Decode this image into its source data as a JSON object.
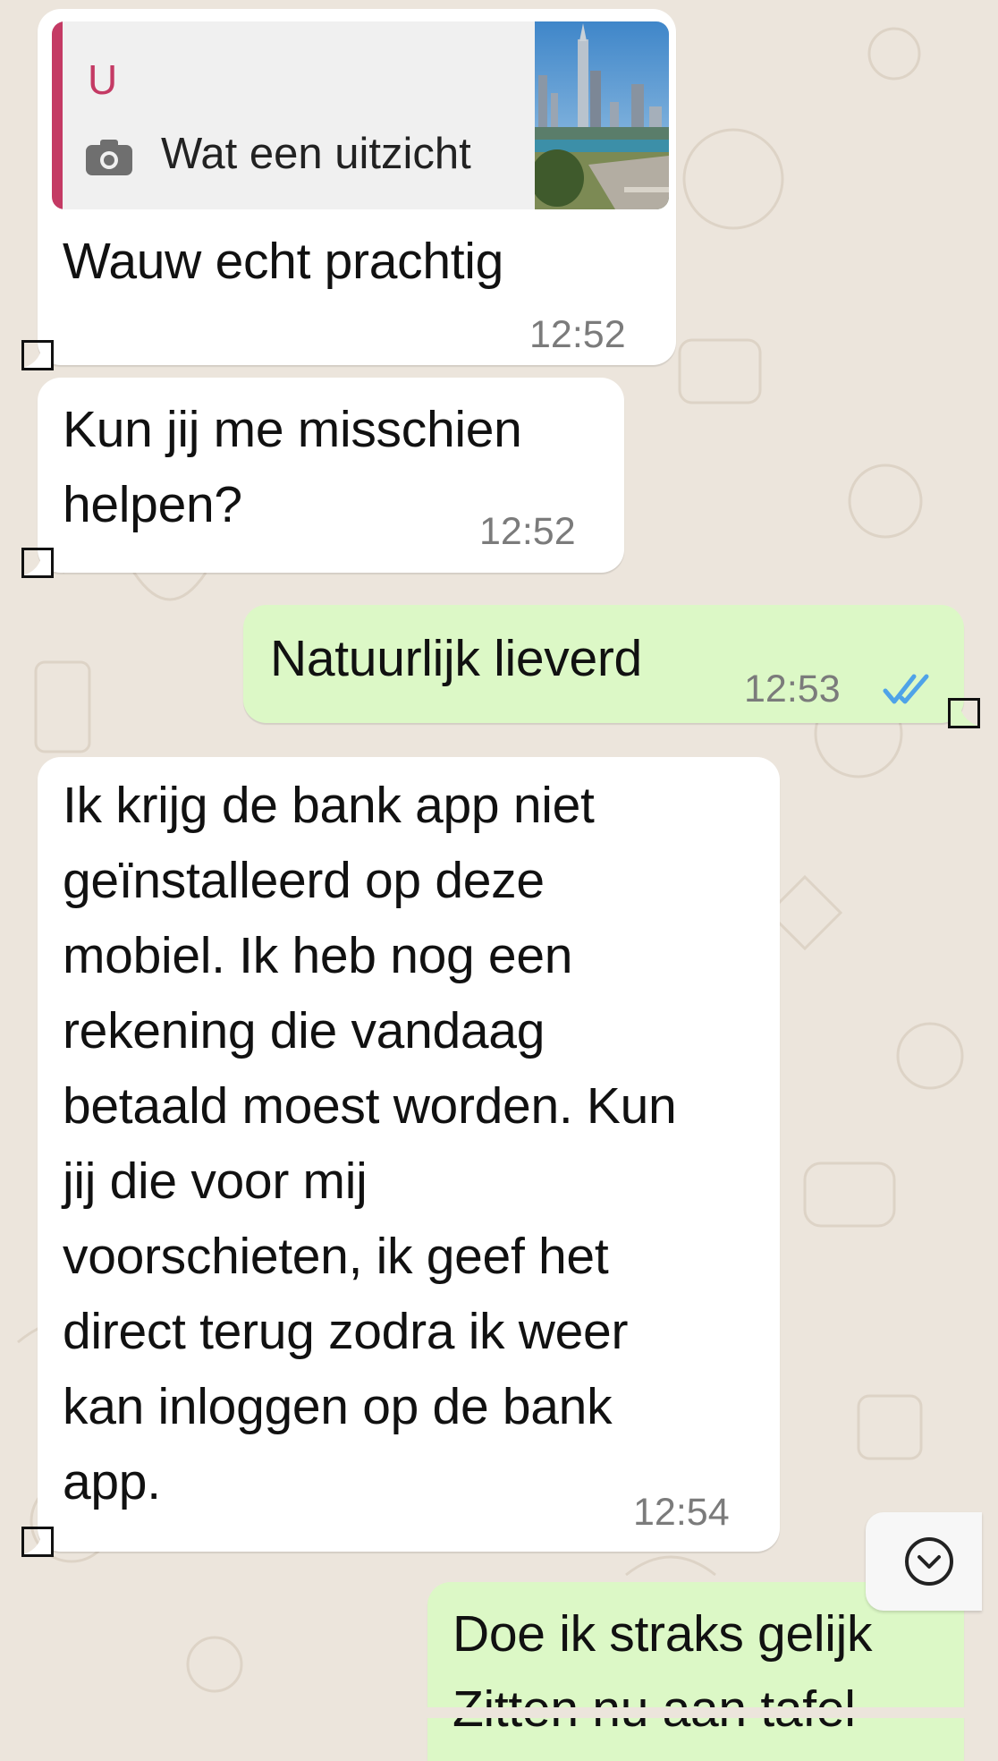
{
  "messages": [
    {
      "id": "m1",
      "direction": "incoming",
      "quote": {
        "author": "U",
        "media_icon": "camera-icon",
        "text": "Wat een uitzicht",
        "thumbnail": "city-skyline-photo"
      },
      "lines": [
        "Wauw echt prachtig"
      ],
      "time": "12:52"
    },
    {
      "id": "m2",
      "direction": "incoming",
      "lines": [
        "Kun jij me misschien",
        "helpen?"
      ],
      "time": "12:52"
    },
    {
      "id": "m3",
      "direction": "outgoing",
      "lines": [
        "Natuurlijk lieverd"
      ],
      "time": "12:53",
      "status_icon": "double-check-read-icon",
      "status_color": "#4fa3e8"
    },
    {
      "id": "m4",
      "direction": "incoming",
      "lines": [
        "Ik krijg de bank app niet",
        "geïnstalleerd op deze",
        "mobiel. Ik heb nog een",
        "rekening die vandaag",
        "betaald moest worden. Kun",
        "jij die voor mij",
        "voorschieten, ik geef het",
        "direct terug zodra ik weer",
        "kan inloggen op de bank",
        "app."
      ],
      "time": "12:54"
    },
    {
      "id": "m5",
      "direction": "outgoing",
      "lines": [
        "Doe ik straks gelijk",
        "Zitten nu aan tafel"
      ]
    }
  ],
  "scroll_button_icon": "chevron-down-icon",
  "colors": {
    "background": "#ece5dc",
    "incoming_bubble": "#ffffff",
    "outgoing_bubble": "#dcf8c6",
    "quote_accent": "#c43a64",
    "time_text": "#7b7b7b",
    "read_ticks": "#4fa3e8"
  }
}
